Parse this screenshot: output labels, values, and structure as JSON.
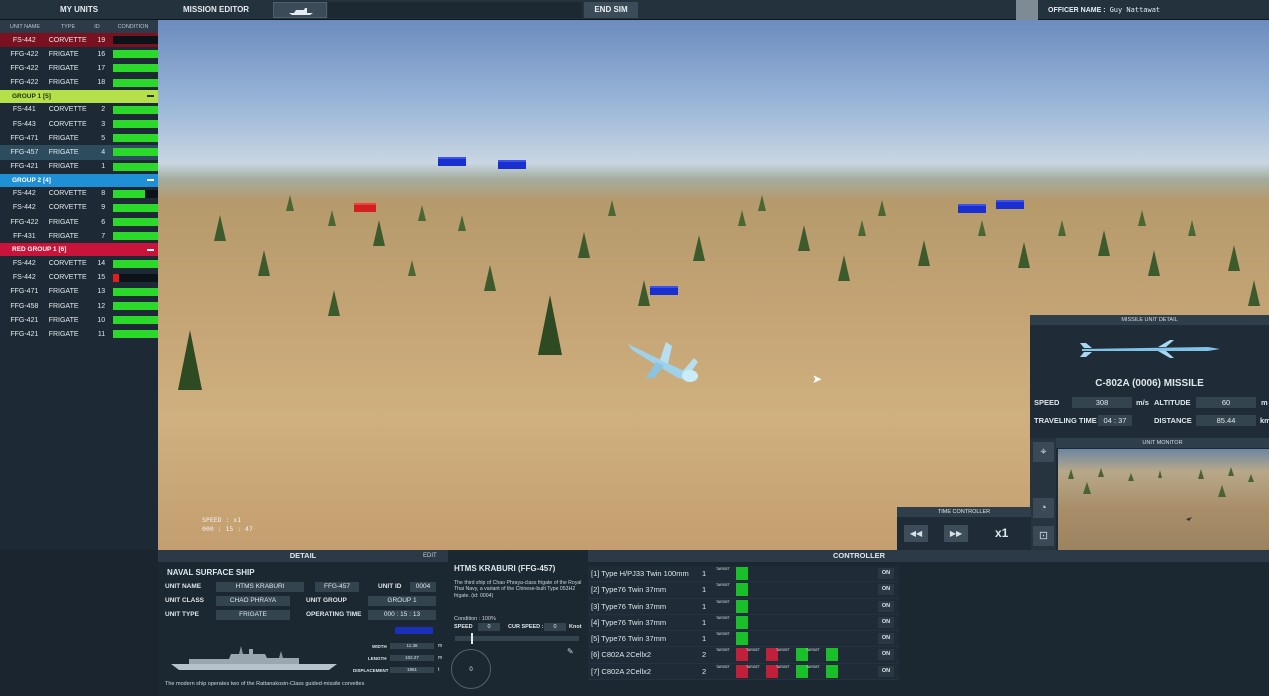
{
  "topbar": {
    "my_units": "MY UNITS",
    "mission_editor": "MISSION EDITOR",
    "end_sim": "END SIM",
    "officer_label": "OFFICER NAME :",
    "officer_name": "Guy Nattawat"
  },
  "unit_list": {
    "headers": [
      "UNIT NAME",
      "TYPE",
      "ID",
      "CONDITION"
    ],
    "ungrouped": [
      {
        "name": "FS-442",
        "type": "CORVETTE",
        "id": "19",
        "condition": 0.0,
        "red": true
      },
      {
        "name": "FFG-422",
        "type": "FRIGATE",
        "id": "16",
        "condition": 1.0
      },
      {
        "name": "FFG-422",
        "type": "FRIGATE",
        "id": "17",
        "condition": 1.0
      },
      {
        "name": "FFG-422",
        "type": "FRIGATE",
        "id": "18",
        "condition": 1.0
      }
    ],
    "groups": [
      {
        "label": "GROUP 1 [5]",
        "color": "#b5e04a",
        "text_color": "#22310a",
        "units": [
          {
            "name": "FS-441",
            "type": "CORVETTE",
            "id": "2",
            "condition": 1.0
          },
          {
            "name": "FS-443",
            "type": "CORVETTE",
            "id": "3",
            "condition": 1.0
          },
          {
            "name": "FFG-471",
            "type": "FRIGATE",
            "id": "5",
            "condition": 1.0
          },
          {
            "name": "FFG-457",
            "type": "FRIGATE",
            "id": "4",
            "condition": 1.0,
            "selected": true
          },
          {
            "name": "FFG-421",
            "type": "FRIGATE",
            "id": "1",
            "condition": 1.0
          }
        ]
      },
      {
        "label": "GROUP 2 [4]",
        "color": "#1f8fd6",
        "text_color": "#ffffff",
        "units": [
          {
            "name": "FS-442",
            "type": "CORVETTE",
            "id": "8",
            "condition": 0.72
          },
          {
            "name": "FS-442",
            "type": "CORVETTE",
            "id": "9",
            "condition": 1.0
          },
          {
            "name": "FFG-422",
            "type": "FRIGATE",
            "id": "6",
            "condition": 1.0
          },
          {
            "name": "FF-431",
            "type": "FRIGATE",
            "id": "7",
            "condition": 1.0
          }
        ]
      },
      {
        "label": "RED GROUP 1 [6]",
        "color": "#c8143a",
        "text_color": "#ffffff",
        "units": [
          {
            "name": "FS-442",
            "type": "CORVETTE",
            "id": "14",
            "condition": 1.0
          },
          {
            "name": "FS-442",
            "type": "CORVETTE",
            "id": "15",
            "condition": 0.12,
            "critical": true
          },
          {
            "name": "FFG-471",
            "type": "FRIGATE",
            "id": "13",
            "condition": 1.0
          },
          {
            "name": "FFG-458",
            "type": "FRIGATE",
            "id": "12",
            "condition": 1.0
          },
          {
            "name": "FFG-421",
            "type": "FRIGATE",
            "id": "10",
            "condition": 1.0
          },
          {
            "name": "FFG-421",
            "type": "FRIGATE",
            "id": "11",
            "condition": 1.0
          }
        ]
      }
    ]
  },
  "viewport": {
    "hud_speed": "SPEED : x1",
    "hud_time": "000 : 15 : 47"
  },
  "missile_detail": {
    "header": "MISSILE UNIT DETAIL",
    "name": "C-802A (0006) MISSILE",
    "speed_label": "SPEED",
    "speed_value": "308",
    "speed_unit": "m/s",
    "altitude_label": "ALTITUDE",
    "altitude_value": "60",
    "altitude_unit": "m",
    "travel_label": "TRAVELING TIME",
    "travel_value": "04 : 37",
    "distance_label": "DISTANCE",
    "distance_value": "85.44",
    "distance_unit": "km"
  },
  "unit_monitor": {
    "header": "UNIT MONITOR"
  },
  "time_controller": {
    "header": "TIME CONTROLLER",
    "multiplier": "x1"
  },
  "detail": {
    "header": "DETAIL",
    "edit": "EDIT",
    "section": "NAVAL SURFACE SHIP",
    "unit_name_label": "UNIT NAME",
    "unit_name": "HTMS KRABURI",
    "hull": "FFG-457",
    "unit_id_label": "UNIT ID",
    "unit_id": "0004",
    "unit_class_label": "UNIT CLASS",
    "unit_class": "CHAO PHRAYA",
    "unit_group_label": "UNIT GROUP",
    "unit_group": "GROUP 1",
    "unit_type_label": "UNIT TYPE",
    "unit_type": "FRIGATE",
    "op_time_label": "OPERATING TIME",
    "op_time": "000 : 15 : 13",
    "width_label": "WIDTH",
    "width_value": "11.36",
    "length_label": "LENGTH",
    "length_value": "102.27",
    "disp_label": "DISPLACEMENT",
    "disp_value": "1961",
    "unit_m": "m",
    "unit_t": "t",
    "footer": "The modern ship operates two of the Rattanakosin-Class guided-missile corvettes",
    "title": "HTMS KRABURI (FFG-457)",
    "description": "The third ship of Chao Phraya-class frigate of the Royal Thai Navy, a variant of the Chinese-built Type 053H2 frigate. (id: 0004)",
    "condition": "Condition : 100%",
    "speed_label": "SPEED",
    "speed_value": "0",
    "cur_speed_label": "CUR SPEED :",
    "cur_speed_value": "0",
    "knot": "Knot",
    "dial_value": "0"
  },
  "controller": {
    "header": "CONTROLLER",
    "target_label": "TARGET",
    "weapons": [
      {
        "name": "[1] Type H/PJ33 Twin 100mm",
        "qty": "1",
        "targets": 1,
        "on": "ON"
      },
      {
        "name": "[2] Type76 Twin 37mm",
        "qty": "1",
        "targets": 1,
        "on": "ON"
      },
      {
        "name": "[3] Type76 Twin 37mm",
        "qty": "1",
        "targets": 1,
        "on": "ON"
      },
      {
        "name": "[4] Type76 Twin 37mm",
        "qty": "1",
        "targets": 1,
        "on": "ON"
      },
      {
        "name": "[5] Type76 Twin 37mm",
        "qty": "1",
        "targets": 1,
        "on": "ON"
      },
      {
        "name": "[6] C802A 2Cellx2",
        "qty": "2",
        "targets": 4,
        "on": "ON"
      },
      {
        "name": "[7] C802A 2Cellx2",
        "qty": "2",
        "targets": 4,
        "on": "ON"
      }
    ]
  },
  "colors": {
    "condition_good": "#2bd92b",
    "condition_critical": "#e02020",
    "friendly_marker": "#1a2fd0",
    "hostile_marker": "#d02020"
  }
}
